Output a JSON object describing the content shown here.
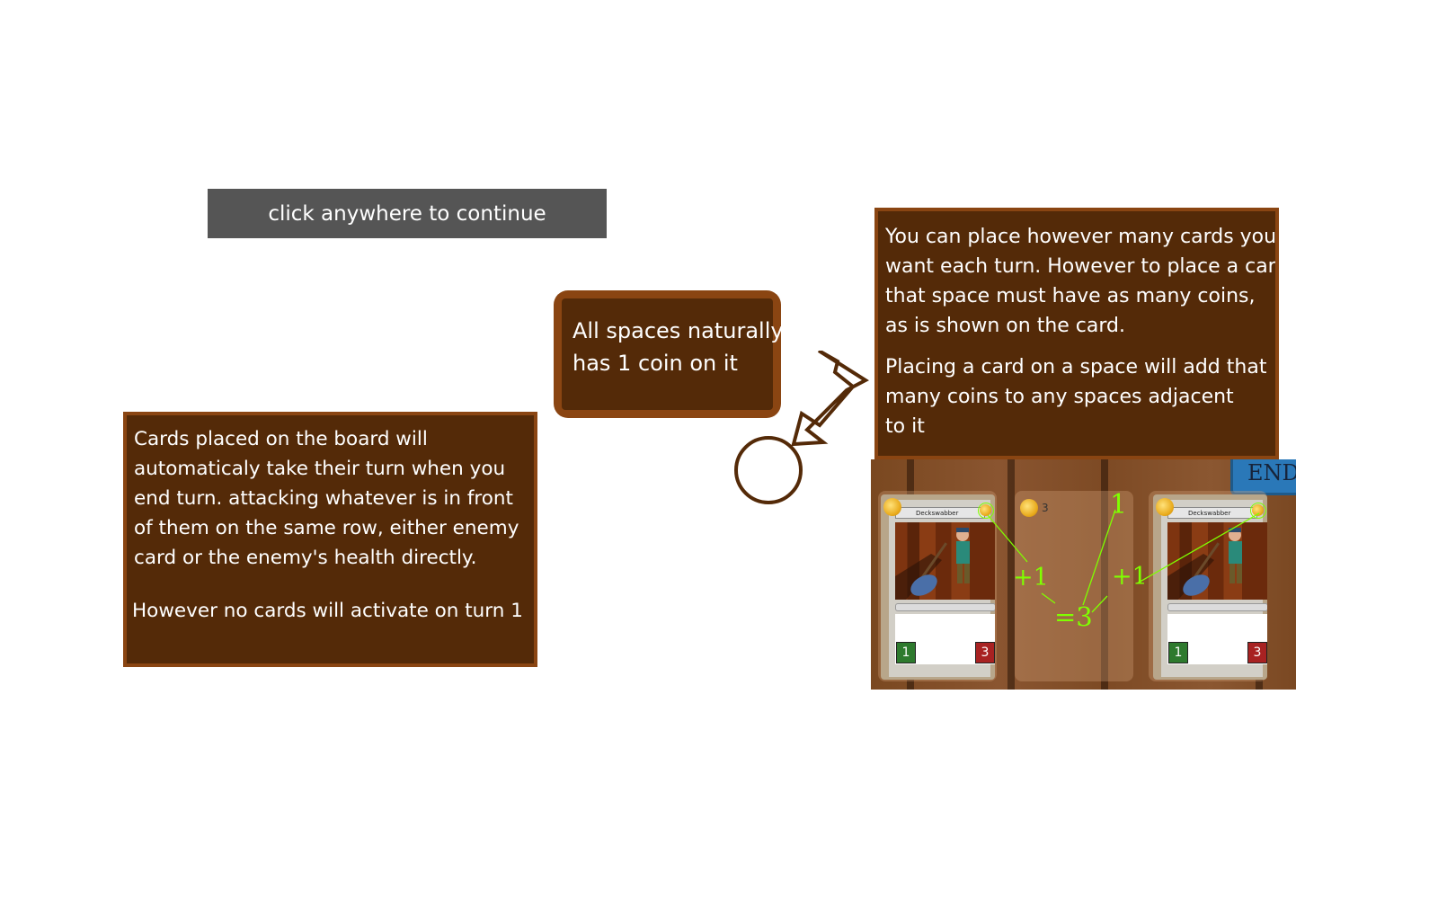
{
  "tutorial": {
    "continue_label": "click anywhere to continue",
    "left_panel": {
      "para1": "Cards placed on the board will automaticaly take their turn when you end turn. attacking whatever is in front of them on the same row, either enemy card or the enemy's health directly.",
      "para2": "However no cards will activate on turn 1"
    },
    "coin_note": {
      "line1": "All spaces naturally",
      "line2": "has 1 coin on it"
    },
    "right_panel": {
      "p1_lines": [
        "You can place however many cards you",
        "want each turn. However to place a card",
        "that space must have as many coins,",
        "as is shown on the card."
      ],
      "p2_lines": [
        "Placing a card on a space will add that",
        "many coins to any spaces adjacent",
        "to it"
      ]
    }
  },
  "board": {
    "end_button_label": "END",
    "cards": [
      {
        "name": "Deckswabber",
        "cost": "1",
        "attack": "1",
        "health": "3"
      },
      {
        "name": "Deckswabber",
        "cost": "1",
        "attack": "1",
        "health": "3"
      }
    ],
    "middle_space_coins": "3",
    "annotations": {
      "natural": "1",
      "left_bonus": "+1",
      "right_bonus": "+1",
      "total": "=3"
    },
    "annotation_color": "#7fff00"
  },
  "colors": {
    "panel_bg": "#542a08",
    "panel_border": "#8a4512",
    "button_bg": "#555555"
  }
}
